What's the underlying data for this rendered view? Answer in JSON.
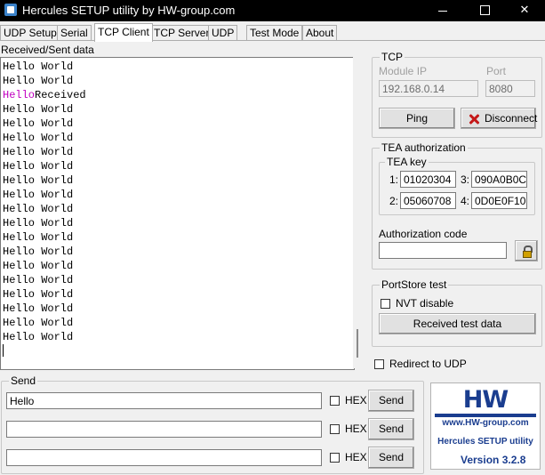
{
  "window": {
    "title": "Hercules SETUP utility by HW-group.com"
  },
  "tabs": [
    "UDP Setup",
    "Serial",
    "TCP Client",
    "TCP Server",
    "UDP",
    "Test Mode",
    "About"
  ],
  "received": {
    "label": "Received/Sent data",
    "lines": [
      {
        "text": "Hello World"
      },
      {
        "text": "Hello World"
      },
      {
        "sent": "Hello",
        "text": "Received"
      },
      {
        "text": "Hello World"
      },
      {
        "text": "Hello World"
      },
      {
        "text": "Hello World"
      },
      {
        "text": "Hello World"
      },
      {
        "text": "Hello World"
      },
      {
        "text": "Hello World"
      },
      {
        "text": "Hello World"
      },
      {
        "text": "Hello World"
      },
      {
        "text": "Hello World"
      },
      {
        "text": "Hello World"
      },
      {
        "text": "Hello World"
      },
      {
        "text": "Hello World"
      },
      {
        "text": "Hello World"
      },
      {
        "text": "Hello World"
      },
      {
        "text": "Hello World"
      },
      {
        "text": "Hello World"
      },
      {
        "text": "Hello World"
      }
    ]
  },
  "tcp": {
    "legend": "TCP",
    "module_ip_label": "Module IP",
    "module_ip": "192.168.0.14",
    "port_label": "Port",
    "port": "8080",
    "ping_label": "Ping",
    "disconnect_label": "Disconnect"
  },
  "tea": {
    "legend": "TEA authorization",
    "key_legend": "TEA key",
    "k1_label": "1:",
    "k1": "01020304",
    "k2_label": "2:",
    "k2": "05060708",
    "k3_label": "3:",
    "k3": "090A0B0C",
    "k4_label": "4:",
    "k4": "0D0E0F10",
    "auth_label": "Authorization code",
    "auth_value": ""
  },
  "portstore": {
    "legend": "PortStore test",
    "nvt_label": "NVT disable",
    "received_test_label": "Received test data"
  },
  "redirect_label": "Redirect to UDP",
  "send": {
    "legend": "Send",
    "rows": [
      {
        "value": "Hello",
        "hex_label": "HEX",
        "button": "Send"
      },
      {
        "value": "",
        "hex_label": "HEX",
        "button": "Send"
      },
      {
        "value": "",
        "hex_label": "HEX",
        "button": "Send"
      }
    ]
  },
  "logo": {
    "brand": "HW",
    "site": "www.HW-group.com",
    "product": "Hercules SETUP utility",
    "version": "Version  3.2.8"
  }
}
